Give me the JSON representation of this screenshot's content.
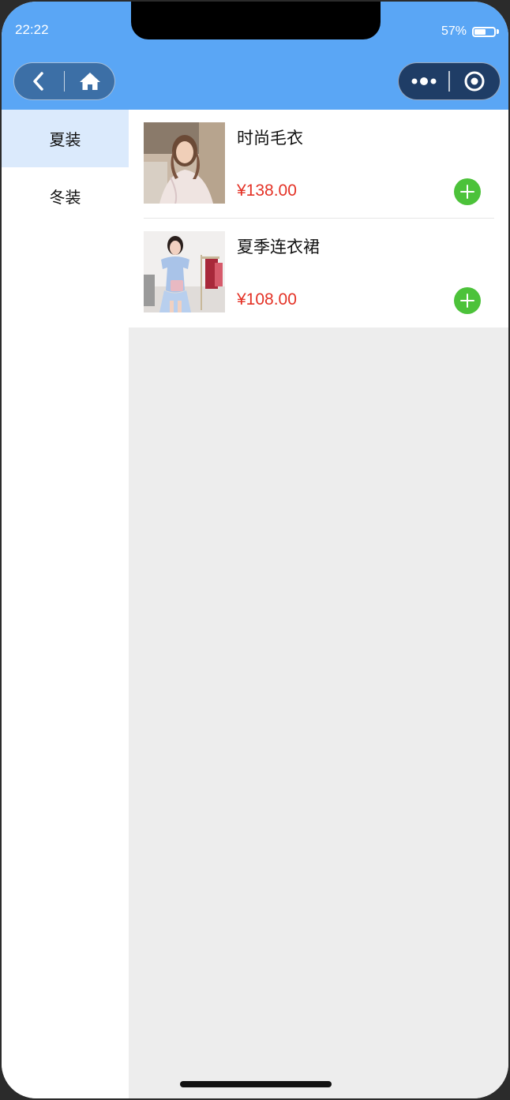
{
  "status_bar": {
    "time": "22:22",
    "battery_percent": "57%",
    "battery_level": 0.57
  },
  "nav": {
    "back_icon": "chevron-left-icon",
    "home_icon": "home-icon",
    "more_icon": "more-dots-icon",
    "close_icon": "target-circle-icon"
  },
  "categories": [
    {
      "label": "夏装",
      "active": true
    },
    {
      "label": "冬装",
      "active": false
    }
  ],
  "products": [
    {
      "name": "时尚毛衣",
      "price": "¥138.00"
    },
    {
      "name": "夏季连衣裙",
      "price": "¥108.00"
    }
  ],
  "colors": {
    "header": "#5aa6f5",
    "active_category": "#dbeafc",
    "price": "#e43226",
    "add_button": "#4cc23a",
    "content_bg": "#ededed"
  }
}
